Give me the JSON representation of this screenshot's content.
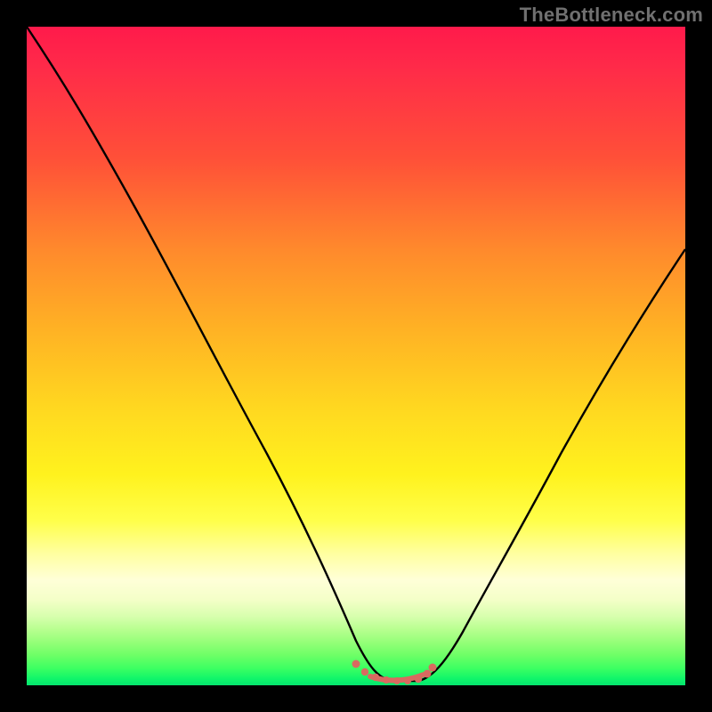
{
  "watermark": "TheBottleneck.com",
  "colors": {
    "frame": "#000000",
    "watermark": "#707070",
    "curve": "#000000",
    "trough_marker": "#d96a60"
  },
  "chart_data": {
    "type": "line",
    "title": "",
    "xlabel": "",
    "ylabel": "",
    "xlim": [
      0,
      100
    ],
    "ylim": [
      0,
      100
    ],
    "grid": false,
    "legend": false,
    "annotations": [],
    "background_gradient": {
      "orientation": "vertical",
      "stops": [
        {
          "pos": 0.0,
          "color": "#ff1a4b"
        },
        {
          "pos": 0.2,
          "color": "#ff5038"
        },
        {
          "pos": 0.46,
          "color": "#ffb224"
        },
        {
          "pos": 0.68,
          "color": "#fff21e"
        },
        {
          "pos": 0.84,
          "color": "#ffffd8"
        },
        {
          "pos": 0.92,
          "color": "#b8ff90"
        },
        {
          "pos": 1.0,
          "color": "#05e56e"
        }
      ]
    },
    "series": [
      {
        "name": "bottleneck-curve",
        "x": [
          0,
          5,
          10,
          15,
          20,
          25,
          30,
          35,
          40,
          45,
          48,
          50,
          53,
          56,
          58,
          60,
          65,
          70,
          75,
          80,
          85,
          90,
          95,
          100
        ],
        "y": [
          100,
          90,
          80,
          71,
          62,
          53,
          44,
          35,
          26,
          16,
          10,
          5,
          2,
          1,
          1,
          2,
          7,
          14,
          22,
          31,
          41,
          51,
          59,
          66
        ]
      },
      {
        "name": "trough-marker",
        "x": [
          50,
          51,
          52,
          53,
          54,
          55,
          56,
          57,
          58,
          59,
          60
        ],
        "y": [
          3,
          2.2,
          1.6,
          1.2,
          1.0,
          1.0,
          1.0,
          1.2,
          1.6,
          2.4,
          3.4
        ]
      }
    ],
    "trough_range_x": [
      50,
      60
    ]
  }
}
